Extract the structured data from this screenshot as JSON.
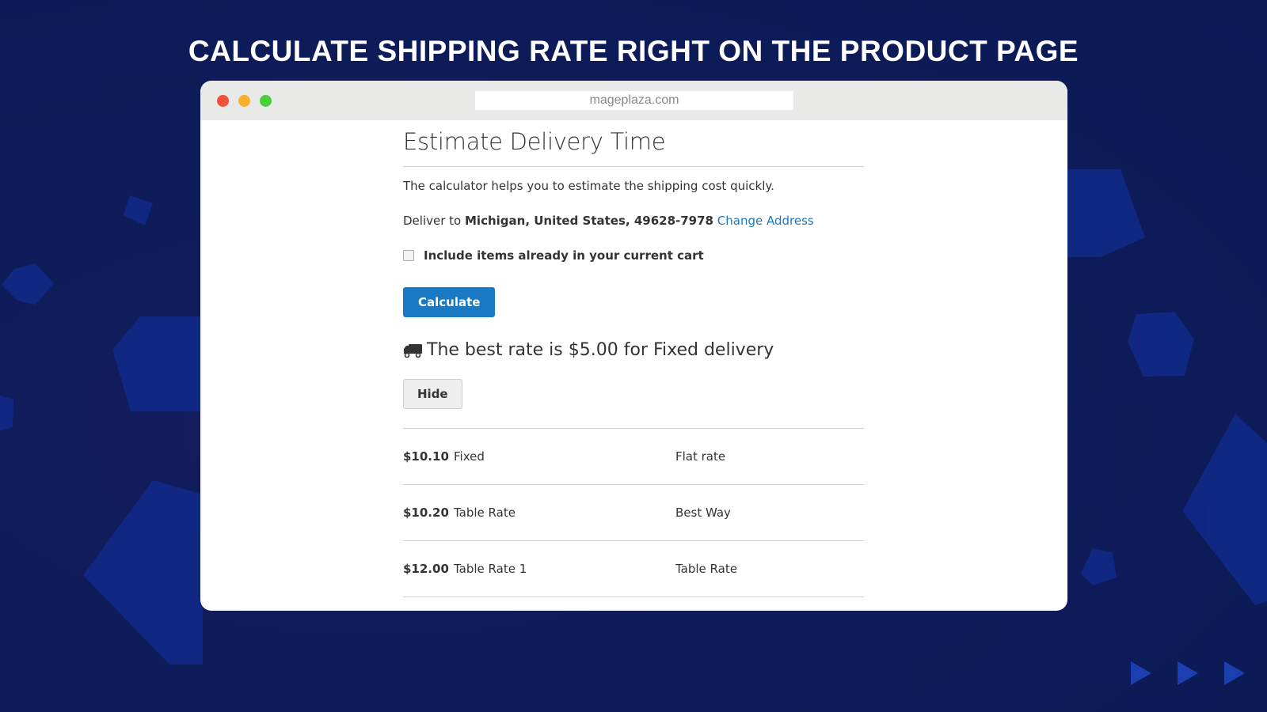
{
  "headline": "CALCULATE SHIPPING RATE RIGHT ON THE PRODUCT PAGE",
  "browser": {
    "url": "mageplaza.com"
  },
  "page": {
    "title": "Estimate Delivery Time",
    "description": "The calculator helps you to estimate the shipping cost quickly.",
    "deliver_prefix": "Deliver to",
    "deliver_address": "Michigan, United States, 49628-7978",
    "change_address_label": "Change Address",
    "include_cart_label": "Include items already in your current cart",
    "include_cart_checked": false,
    "calculate_label": "Calculate",
    "best_rate_icon": "truck-icon",
    "best_rate_text": "The best rate is $5.00 for Fixed delivery",
    "hide_label": "Hide",
    "rates": [
      {
        "price": "$10.10",
        "method": "Fixed",
        "carrier": "Flat rate"
      },
      {
        "price": "$10.20",
        "method": "Table Rate",
        "carrier": "Best Way"
      },
      {
        "price": "$12.00",
        "method": "Table Rate 1",
        "carrier": "Table Rate"
      }
    ]
  },
  "colors": {
    "accent": "#1979c3",
    "background": "#0f1c5a"
  }
}
